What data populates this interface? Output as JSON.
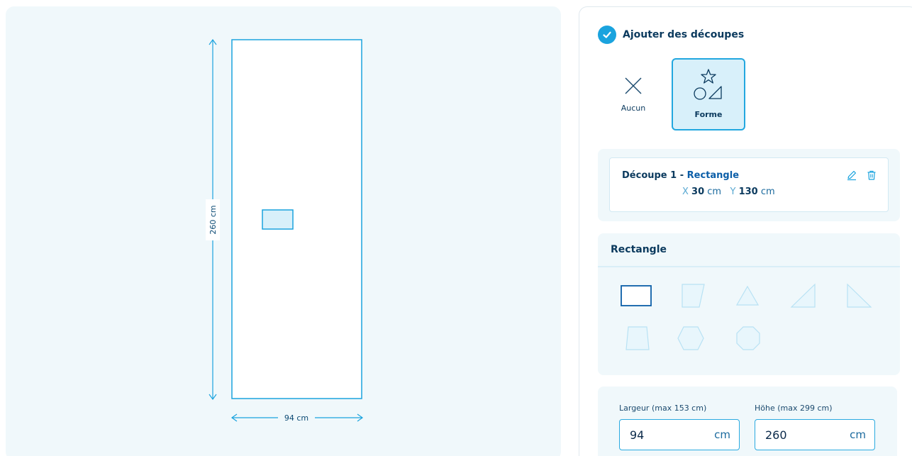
{
  "preview": {
    "height_label": "260 cm",
    "width_label": "94 cm"
  },
  "config": {
    "step_title": "Ajouter des découpes",
    "options": [
      {
        "label": "Aucun",
        "icon": "close-icon",
        "selected": false
      },
      {
        "label": "Forme",
        "icon": "shapes-icon",
        "selected": true
      }
    ],
    "cut": {
      "title_prefix": "Découpe 1 - ",
      "title_shape": "Rectangle",
      "x_axis": "X",
      "x_value": "30",
      "y_axis": "Y",
      "y_value": "130",
      "unit": "cm"
    },
    "shape_panel": {
      "title": "Rectangle",
      "shapes": [
        "rectangle",
        "trapezoid-slanted",
        "triangle",
        "right-triangle-left",
        "right-triangle-right",
        "trapezoid",
        "hexagon",
        "octagon"
      ],
      "selected_shape": "rectangle"
    },
    "dimensions": {
      "width_label": "Largeur (max 153 cm)",
      "width_value": "94",
      "height_label": "Höhe (max 299 cm)",
      "height_value": "260",
      "unit": "cm"
    }
  },
  "colors": {
    "accent": "#1aa3de",
    "dark_text": "#0b3a5e",
    "panel_bg": "#f0f8fb"
  }
}
